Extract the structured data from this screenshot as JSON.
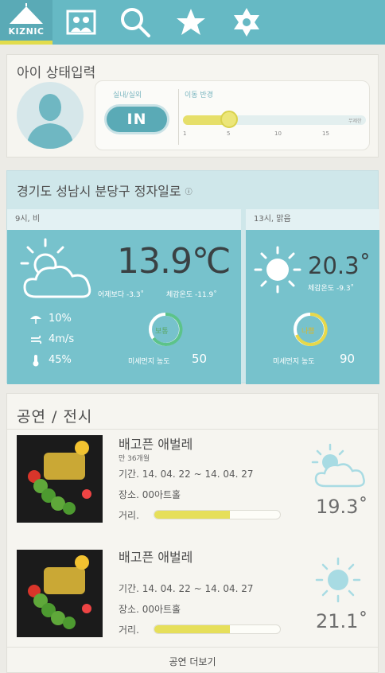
{
  "nav": {
    "logo_text": "KIZNIC",
    "tabs": [
      {
        "icon": "photo-icon",
        "active": false
      },
      {
        "icon": "search-icon",
        "active": false
      },
      {
        "icon": "star-icon",
        "active": false
      },
      {
        "icon": "gear-icon",
        "active": false
      }
    ],
    "accent": "#e2dc4c",
    "bar_color": "#66b9c4"
  },
  "child_state": {
    "title": "아이 상태입력",
    "indoor_label": "실내/실외",
    "indoor_value": "IN",
    "activity_label": "이동 반경",
    "slider_ticks": [
      "1",
      "5",
      "10",
      "15"
    ],
    "slider_end": "무제한",
    "slider_value": 5,
    "slider_max": 20
  },
  "weather": {
    "location": "경기도 성남시 분당구 정자일로",
    "info_icon": "ⓘ",
    "now": {
      "time": "9시, 비",
      "temp": "13.9℃",
      "yesterday": "어제보다 -3.3˚",
      "feels": "체감온도 -11.9˚",
      "rain": "10%",
      "wind": "4m/s",
      "humidity": "45%",
      "dust_grade": "보통",
      "dust_label": "미세먼지 농도",
      "dust_value": "50"
    },
    "later": {
      "time": "13시, 맑음",
      "temp": "20.3˚",
      "feels": "체감온도 -9.3˚",
      "dust_grade": "나쁨",
      "dust_label": "미세먼지 농도",
      "dust_value": "90"
    }
  },
  "shows": {
    "title": "공연 / 전시",
    "items": [
      {
        "name": "배고픈 애벌레",
        "age": "만 36개월",
        "period": "기간. 14. 04. 22 ~ 14. 04. 27",
        "place": "장소. 00아트홀",
        "distance_label": "거리.",
        "distance": 0.6,
        "weather_icon": "partly-cloudy-icon",
        "temp": "19.3˚"
      },
      {
        "name": "배고픈 애벌레",
        "age": "",
        "period": "기간. 14. 04. 22 ~ 14. 04. 27",
        "place": "장소. 00아트홀",
        "distance_label": "거리.",
        "distance": 0.6,
        "weather_icon": "sunny-icon",
        "temp": "21.1˚"
      }
    ],
    "more_label": "공연 더보기"
  }
}
